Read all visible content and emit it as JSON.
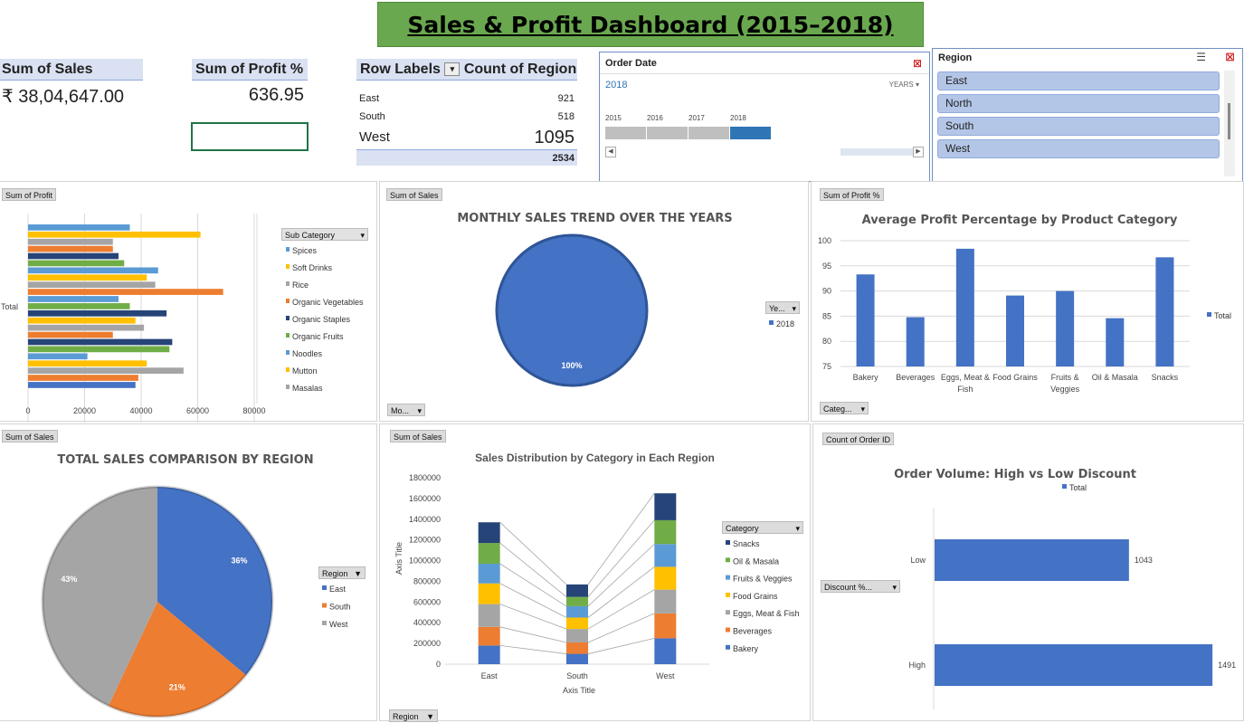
{
  "dashboard_title": "Sales & Profit Dashboard (2015–2018)",
  "kpis": {
    "sales_label": "Sum of Sales",
    "sales_value": "₹  38,04,647.00",
    "profit_label": "Sum of Profit %",
    "profit_value": "636.95"
  },
  "region_pivot": {
    "col1": "Row Labels",
    "col2": "Count of Region",
    "rows": [
      {
        "label": "East",
        "value": "921"
      },
      {
        "label": "South",
        "value": "518"
      },
      {
        "label": "West",
        "value": "1095"
      }
    ],
    "total": "2534"
  },
  "date_slicer": {
    "title": "Order  Date",
    "selected": "2018",
    "level": "YEARS",
    "years": [
      "2015",
      "2016",
      "2017",
      "2018"
    ],
    "selected_index": 3
  },
  "region_slicer": {
    "title": "Region",
    "items": [
      "East",
      "North",
      "South",
      "West"
    ]
  },
  "panel_buttons": {
    "profit_bar": "Sum of Profit",
    "monthly": "Sum of Sales",
    "avgprofit": "Sum of Profit %",
    "region_pie": "Sum of Sales",
    "stacked": "Sum of Sales",
    "orders": "Count of Order ID",
    "monthly_field": "Mo...",
    "year_field": "Ye...",
    "categ_field": "Categ...",
    "subcat_field": "Sub Category",
    "category_field": "Category",
    "region_field": "Region",
    "region_field2": "Region",
    "discount_field": "Discount %..."
  },
  "colors": {
    "accent_blue": "#4472c4",
    "orange": "#ed7d31",
    "gray": "#a5a5a5",
    "gold": "#ffc000",
    "light_blue": "#5b9bd5",
    "green": "#70ad47",
    "navy": "#264478",
    "title_green": "#6aa84f"
  },
  "chart_data": [
    {
      "id": "profit_by_subcategory",
      "type": "bar",
      "orientation": "horizontal",
      "category_label": "Total",
      "xlim": [
        0,
        80000
      ],
      "xticks": [
        0,
        20000,
        40000,
        60000,
        80000
      ],
      "tick_labels": [
        "0",
        "20000",
        "40000",
        "60000",
        "80000"
      ],
      "series_field": "Sub Category",
      "legend_visible": [
        "Spices",
        "Soft Drinks",
        "Rice",
        "Organic Vegetables",
        "Organic Staples",
        "Organic Fruits",
        "Noodles",
        "Mutton",
        "Masalas"
      ],
      "values": [
        36000,
        61000,
        30000,
        30000,
        32000,
        34000,
        46000,
        42000,
        45000,
        69000,
        32000,
        36000,
        49000,
        38000,
        41000,
        30000,
        51000,
        50000,
        21000,
        42000,
        55000,
        39000,
        38000
      ]
    },
    {
      "id": "monthly_sales_trend",
      "type": "pie",
      "title": "MONTHLY SALES TREND OVER THE YEARS",
      "legend": [
        "2018"
      ],
      "slices": [
        {
          "label": "2018",
          "value": 100,
          "display": "100%"
        }
      ]
    },
    {
      "id": "avg_profit_pct",
      "type": "bar",
      "title": "Average Profit Percentage by Product Category",
      "categories": [
        "Bakery",
        "Beverages",
        "Eggs, Meat & Fish",
        "Food Grains",
        "Fruits & Veggies",
        "Oil & Masala",
        "Snacks"
      ],
      "values": [
        93.3,
        84.8,
        98.4,
        89.1,
        90.0,
        84.6,
        96.7
      ],
      "ylim": [
        75,
        100
      ],
      "yticks": [
        "75",
        "80",
        "85",
        "90",
        "95",
        "100"
      ],
      "legend": [
        "Total"
      ]
    },
    {
      "id": "sales_by_region",
      "type": "pie",
      "title": "TOTAL SALES COMPARISON BY REGION",
      "legend": [
        "East",
        "South",
        "West"
      ],
      "slices": [
        {
          "label": "East",
          "value": 36,
          "display": "36%"
        },
        {
          "label": "South",
          "value": 21,
          "display": "21%"
        },
        {
          "label": "West",
          "value": 43,
          "display": "43%"
        }
      ]
    },
    {
      "id": "category_by_region",
      "type": "bar",
      "stacked": true,
      "title": "Sales Distribution by Category in Each Region",
      "categories": [
        "East",
        "South",
        "West"
      ],
      "xlabel": "Axis Title",
      "ylabel": "Axis Title",
      "ylim": [
        0,
        1800000
      ],
      "yticks": [
        "0",
        "200000",
        "400000",
        "600000",
        "800000",
        "1000000",
        "1200000",
        "1400000",
        "1600000",
        "1800000"
      ],
      "legend": [
        "Snacks",
        "Oil & Masala",
        "Fruits & Veggies",
        "Food Grains",
        "Eggs, Meat & Fish",
        "Beverages",
        "Bakery"
      ],
      "series": [
        {
          "name": "Bakery",
          "values": [
            180000,
            100000,
            250000
          ]
        },
        {
          "name": "Beverages",
          "values": [
            180000,
            110000,
            240000
          ]
        },
        {
          "name": "Eggs, Meat & Fish",
          "values": [
            220000,
            130000,
            230000
          ]
        },
        {
          "name": "Food Grains",
          "values": [
            200000,
            110000,
            220000
          ]
        },
        {
          "name": "Fruits & Veggies",
          "values": [
            190000,
            110000,
            220000
          ]
        },
        {
          "name": "Oil & Masala",
          "values": [
            200000,
            90000,
            230000
          ]
        },
        {
          "name": "Snacks",
          "values": [
            200000,
            120000,
            260000
          ]
        }
      ]
    },
    {
      "id": "order_volume_discount",
      "type": "bar",
      "orientation": "horizontal",
      "title": "Order Volume: High vs Low Discount",
      "legend": [
        "Total"
      ],
      "categories": [
        "Low",
        "High"
      ],
      "values": [
        1043,
        1491
      ],
      "xlim": [
        0,
        1500
      ]
    }
  ]
}
